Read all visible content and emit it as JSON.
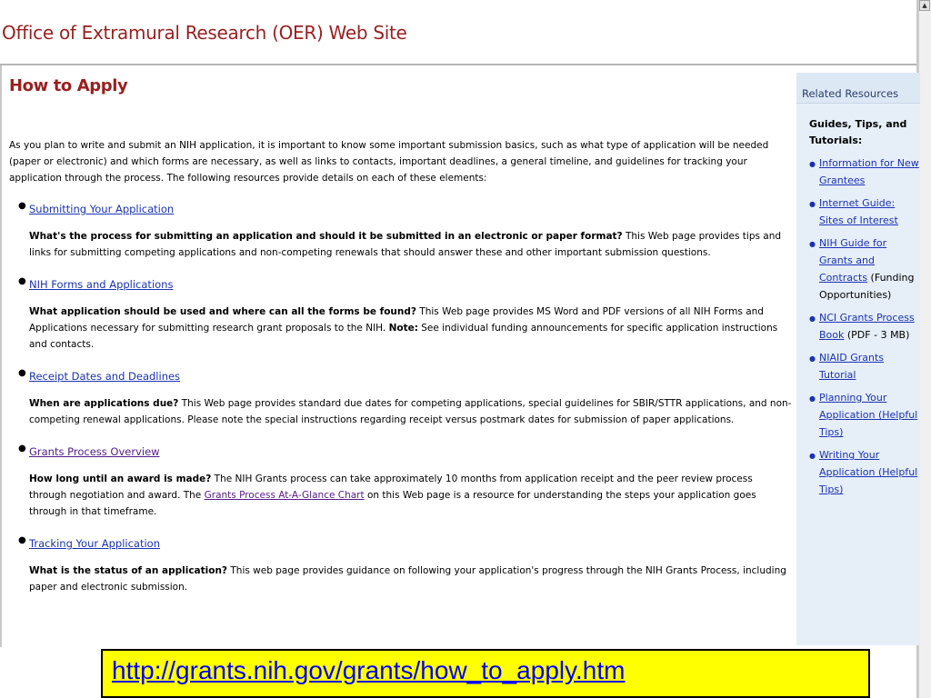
{
  "header": {
    "site_title": "Office of Extramural Research (OER) Web Site"
  },
  "main": {
    "heading": "How to Apply",
    "intro": "As you plan to write and submit an NIH application, it is important to know some important submission basics, such as what type of application will be needed (paper or electronic) and which forms are necessary, as well as links to contacts, important deadlines, a general timeline, and guidelines for tracking your application through the process. The following resources provide details on each of these elements:",
    "items": [
      {
        "link": "Submitting Your Application",
        "question": "What's the process for submitting an application and should it be submitted in an electronic or paper format?",
        "text": " This Web page provides tips and links for submitting competing applications and non-competing renewals that should answer these and other important submission questions."
      },
      {
        "link": "NIH Forms and Applications",
        "question": "What application should be used and where can all the forms be found?",
        "text": " This Web page provides MS Word and PDF versions of all NIH Forms and Applications necessary for submitting research grant proposals to the NIH.  ",
        "note_label": "Note:",
        "note_text": "  See individual funding announcements for specific application instructions and contacts."
      },
      {
        "link": "Receipt Dates and Deadlines",
        "question": "When are applications due?",
        "text": " This Web page provides standard due dates for competing applications, special guidelines for SBIR/STTR applications, and non-competing renewal applications.  Please note the special instructions regarding receipt versus postmark dates for submission of paper applications."
      },
      {
        "link": "Grants Process Overview",
        "question": "How long until an award is made?",
        "text_before": " The NIH Grants process can take approximately 10 months from application receipt and the peer review process through negotiation and award. The ",
        "inline_link": "Grants Process At-A-Glance Chart",
        "text_after": " on this Web page is a resource for understanding the steps your application goes through in that timeframe."
      },
      {
        "link": "Tracking Your Application",
        "question": "What is the status of an application?",
        "text": " This web page provides guidance on following your application's progress through the NIH Grants Process, including paper and electronic submission."
      }
    ]
  },
  "sidebar": {
    "title": "Related Resources",
    "subtitle": "Guides, Tips, and Tutorials:",
    "items": [
      {
        "link": "Information for New Grantees",
        "suffix": ""
      },
      {
        "link": "Internet Guide: Sites of Interest",
        "suffix": ""
      },
      {
        "link": "NIH Guide for Grants and Contracts",
        "suffix": " (Funding Opportunities)"
      },
      {
        "link": "NCI Grants Process Book",
        "suffix": " (PDF - 3 MB)"
      },
      {
        "link": "NIAID Grants Tutorial",
        "suffix": ""
      },
      {
        "link": "Planning Your Application (Helpful Tips)",
        "suffix": ""
      },
      {
        "link": "Writing Your Application (Helpful Tips)",
        "suffix": ""
      }
    ]
  },
  "banner": {
    "url": "http://grants.nih.gov/grants/how_to_apply.htm"
  },
  "colors": {
    "title_red": "#9a1f1f",
    "link_blue": "#1a33b3",
    "visited_purple": "#551a8b",
    "sidebar_bg": "#e6eef8",
    "banner_yellow": "#ffff00"
  }
}
